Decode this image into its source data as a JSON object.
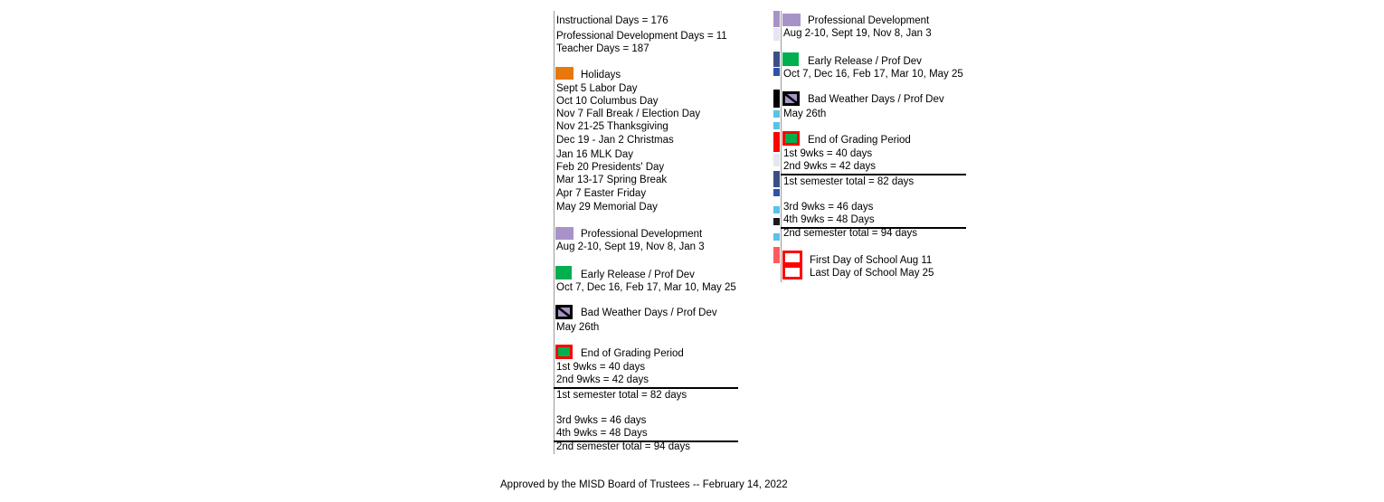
{
  "document": {
    "type": "school-calendar-legend",
    "footer": "Approved by the MISD Board of Trustees -- February 14, 2022"
  },
  "colors": {
    "holidays": "#E8780C",
    "professional_development": "#A893C8",
    "early_release": "#00B050",
    "grading_period_fill": "#00B050",
    "grading_period_border": "#FF0000",
    "bad_weather_fill": "#A893C8",
    "bad_weather_border": "#000000",
    "first_last_day_border": "#FF0000",
    "rule": "#000000",
    "text": "#000000"
  },
  "legend": {
    "summary": {
      "instructional_days": "Instructional Days = 176",
      "professional_development_days": "Professional Development Days = 11",
      "teacher_days": "Teacher Days = 187"
    },
    "holidays": {
      "title": "Holidays",
      "swatch": "orange-square",
      "dates": [
        "Sept 5 Labor Day",
        "Oct 10 Columbus Day",
        "Nov 7 Fall Break / Election Day",
        "Nov 21-25 Thanksgiving",
        "Dec 19 - Jan 2 Christmas",
        "Jan 16 MLK Day",
        "Feb 20 Presidents' Day",
        "Mar 13-17 Spring Break",
        "Apr 7 Easter Friday",
        "May 29 Memorial Day"
      ]
    },
    "professional_development": {
      "title": "Professional Development",
      "swatch": "purple-square",
      "dates": "Aug 2-10, Sept 19, Nov 8, Jan 3"
    },
    "early_release": {
      "title": "Early Release / Prof Dev",
      "swatch": "green-square",
      "dates": "Oct 7, Dec 16, Feb 17, Mar 10, May 25"
    },
    "bad_weather": {
      "title": "Bad Weather Days / Prof Dev",
      "swatch": "purple-square-black-border-diagonal",
      "dates": "May 26th"
    },
    "grading_period": {
      "title": "End of Grading Period",
      "swatch": "green-square-red-border",
      "first_nine_weeks": "1st 9wks = 40 days",
      "second_nine_weeks": "2nd 9wks = 42 days",
      "first_semester_total": "1st semester total = 82 days",
      "third_nine_weeks": "3rd 9wks = 46 days",
      "fourth_nine_weeks": "4th 9wks = 48 Days",
      "second_semester_total": "2nd semester total = 94 days"
    },
    "school_bounds": {
      "swatch": "white-square-red-border",
      "first_day": "First Day of School Aug 11",
      "last_day": "Last Day of School May 25"
    }
  }
}
